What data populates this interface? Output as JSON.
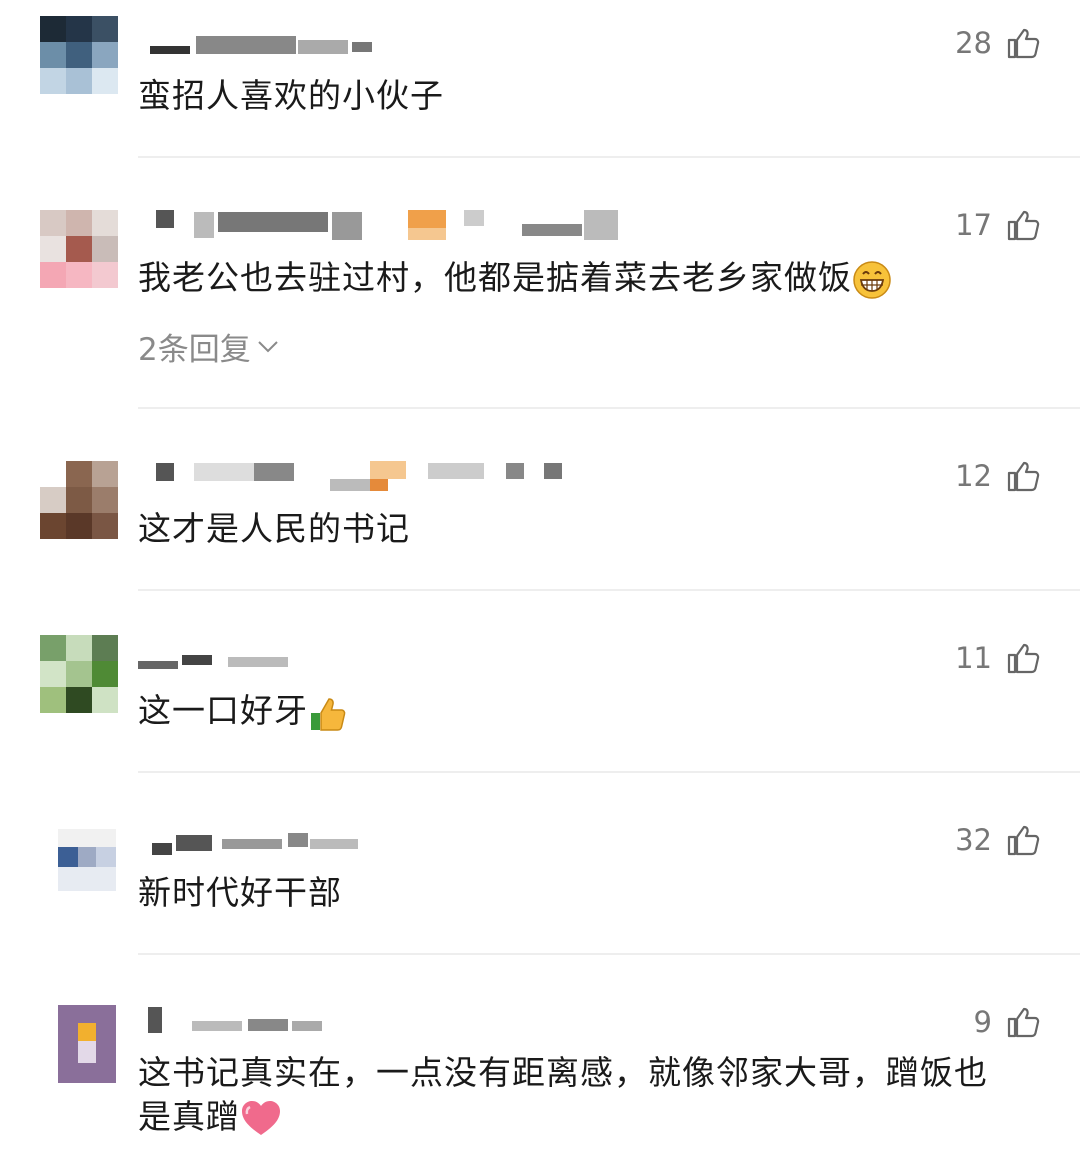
{
  "comments": [
    {
      "text": "蛮招人喜欢的小伙子",
      "likes": "28",
      "emoji": ""
    },
    {
      "text": "我老公也去驻过村，他都是掂着菜去老乡家做饭",
      "likes": "17",
      "emoji": "grinning-face-icon",
      "replies_label": "2条回复"
    },
    {
      "text": "这才是人民的书记",
      "likes": "12",
      "emoji": ""
    },
    {
      "text": "这一口好牙",
      "likes": "11",
      "emoji": "thumbs-up-icon"
    },
    {
      "text": "新时代好干部",
      "likes": "32",
      "emoji": ""
    },
    {
      "text_line1": "这书记真实在，一点没有距离感，就像邻家大哥，蹭饭也",
      "text_line2": "是真蹭",
      "likes": "9",
      "emoji": "heart-icon"
    }
  ],
  "colors": {
    "text": "#1a1a1a",
    "secondary": "#8a8a8a",
    "divider": "#eeeeee"
  }
}
